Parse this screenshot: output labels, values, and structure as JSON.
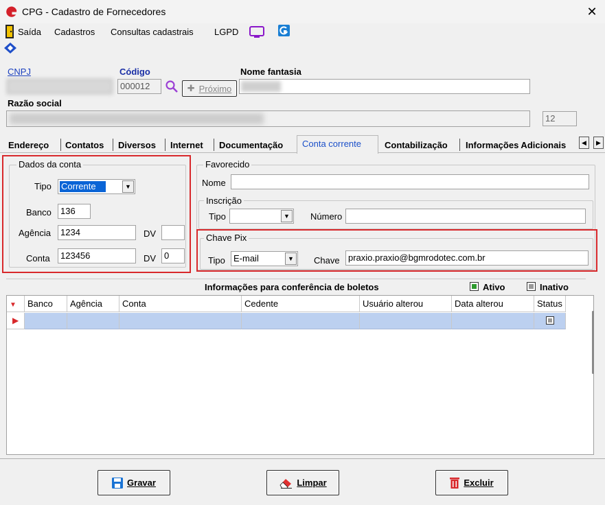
{
  "window": {
    "title": "CPG - Cadastro de Fornecedores",
    "close_glyph": "✕"
  },
  "menu": {
    "items": [
      "Saída",
      "Cadastros",
      "Consultas cadastrais",
      "LGPD"
    ]
  },
  "header": {
    "cnpj_label": "CNPJ",
    "codigo_label": "Código",
    "codigo_value": "000012",
    "proximo_label": "Próximo",
    "nome_fantasia_label": "Nome fantasia",
    "razao_social_label": "Razão social",
    "razao_num": "12"
  },
  "tabs": [
    "Endereço",
    "Contatos",
    "Diversos",
    "Internet",
    "Documentação",
    "Conta corrente",
    "Contabilização",
    "Informações Adicionais"
  ],
  "active_tab": "Conta corrente",
  "dados_conta": {
    "title": "Dados da conta",
    "tipo_label": "Tipo",
    "tipo_value": "Corrente",
    "banco_label": "Banco",
    "banco_value": "136",
    "agencia_label": "Agência",
    "agencia_value": "1234",
    "agencia_dv_label": "DV",
    "agencia_dv_value": "",
    "conta_label": "Conta",
    "conta_value": "123456",
    "conta_dv_label": "DV",
    "conta_dv_value": "0"
  },
  "favorecido": {
    "title": "Favorecido",
    "nome_label": "Nome",
    "nome_value": "",
    "inscricao_title": "Inscrição",
    "tipo_label": "Tipo",
    "tipo_value": "",
    "numero_label": "Número",
    "numero_value": ""
  },
  "pix": {
    "title": "Chave Pix",
    "tipo_label": "Tipo",
    "tipo_value": "E-mail",
    "chave_label": "Chave",
    "chave_value": "praxio.praxio@bgmrodotec.com.br"
  },
  "boletos": {
    "title": "Informações para conferência de boletos",
    "ativo_label": "Ativo",
    "inativo_label": "Inativo",
    "columns": [
      "Banco",
      "Agência",
      "Conta",
      "Cedente",
      "Usuário alterou",
      "Data alterou",
      "Status"
    ]
  },
  "actions": {
    "gravar": "Gravar",
    "limpar": "Limpar",
    "excluir": "Excluir"
  },
  "colors": {
    "accent_red": "#d8282b",
    "link_blue": "#1a3fbf",
    "selected_blue": "#0a64d6",
    "row_blue": "#bcd0f0"
  }
}
